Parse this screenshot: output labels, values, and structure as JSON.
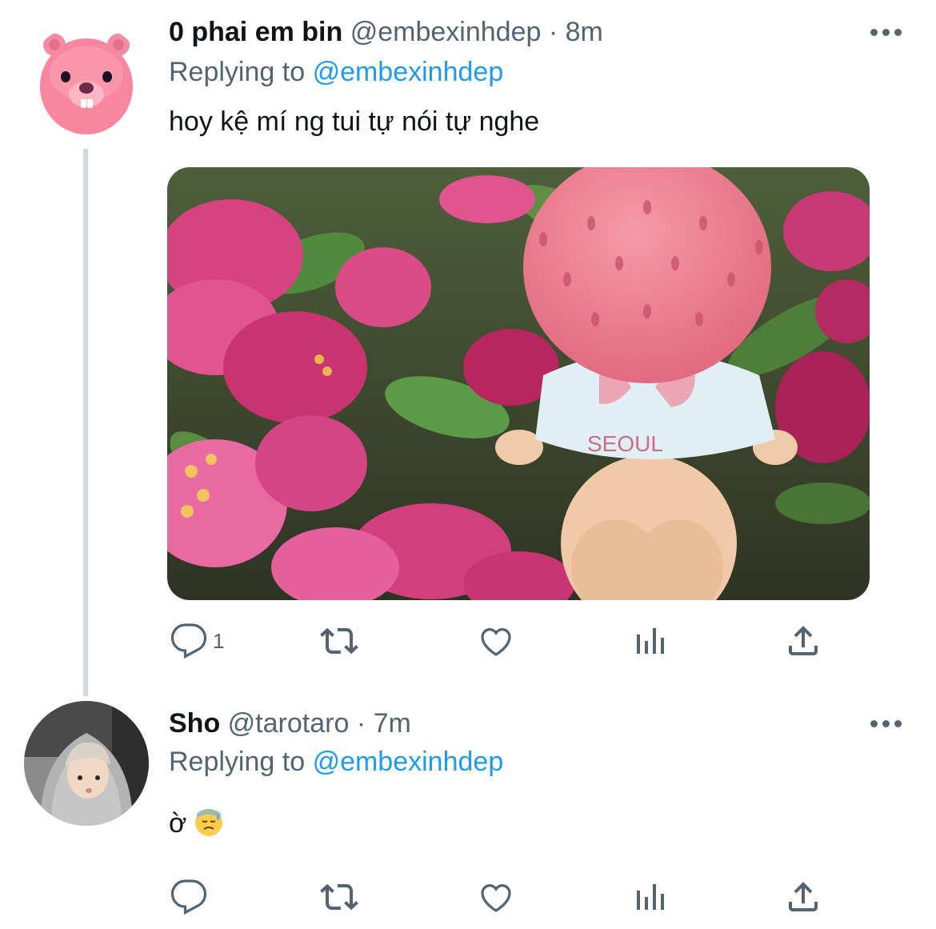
{
  "tweets": [
    {
      "display_name": "0 phai em bin",
      "handle": "@embexinhdep",
      "separator": "·",
      "time": "8m",
      "replying_prefix": "Replying to",
      "replying_to": "@embexinhdep",
      "text": "hoy kệ mí ng tui tự nói tự nghe",
      "avatar": "pink-beaver-avatar",
      "media": {
        "subject": "strawberry-head-figure-with-pink-flowers",
        "shirt_text": "SEOUL"
      },
      "actions": {
        "reply_count": "1"
      }
    },
    {
      "display_name": "Sho",
      "handle": "@tarotaro",
      "separator": "·",
      "time": "7m",
      "replying_prefix": "Replying to",
      "replying_to": "@embexinhdep",
      "text": "ờ",
      "emoji": "downcast-face-with-sweat",
      "avatar": "person-in-grey-hoodie-avatar"
    }
  ],
  "colors": {
    "text": "#0f1419",
    "secondary": "#536471",
    "accent": "#1d9bf0",
    "thread_line": "#cfd9de"
  }
}
